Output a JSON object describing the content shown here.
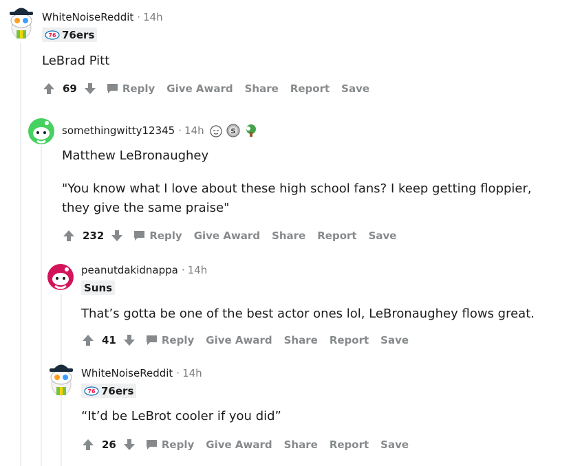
{
  "comments": [
    {
      "username": "WhiteNoiseReddit",
      "time": "14h",
      "flair": "76ers",
      "body": [
        "LeBrad Pitt"
      ],
      "votes": "69"
    },
    {
      "username": "somethingwitty12345",
      "time": "14h",
      "body": [
        "Matthew LeBronaughey",
        "\"You know what I love about these high school fans? I keep getting floppier, they give the same praise\""
      ],
      "votes": "232"
    },
    {
      "username": "peanutdakidnappa",
      "time": "14h",
      "flair": "Suns",
      "body": [
        "That’s gotta be one of the best actor ones lol, LeBronaughey flows great."
      ],
      "votes": "41"
    },
    {
      "username": "WhiteNoiseReddit",
      "time": "14h",
      "flair": "76ers",
      "body": [
        "“It’d be LeBrot cooler if you did”"
      ],
      "votes": "26"
    }
  ],
  "actions": {
    "reply": "Reply",
    "give_award": "Give Award",
    "share": "Share",
    "report": "Report",
    "save": "Save"
  },
  "separator": "·",
  "icons": {
    "upvote": "arrow-up-icon",
    "downvote": "arrow-down-icon",
    "reply": "speech-bubble-icon",
    "flair_76ers": "76ers-logo-icon",
    "awards": [
      "face-award-icon",
      "silver-coin-award-icon",
      "tree-award-icon"
    ]
  },
  "colors": {
    "text": "#1c1c1c",
    "meta": "#7c7c7c",
    "action": "#878a8c",
    "flair_bg": "#edeff1",
    "thread_line": "#edeff1"
  }
}
